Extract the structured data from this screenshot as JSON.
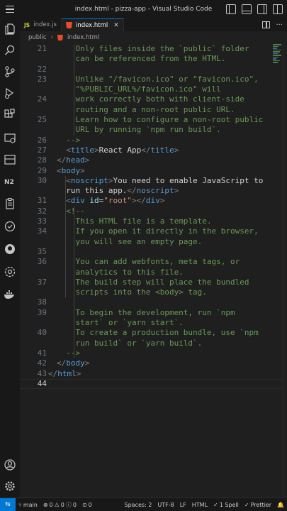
{
  "window": {
    "title": "index.html - pizza-app - Visual Studio Code"
  },
  "tabs": [
    {
      "label": "index.js",
      "badge": "JS"
    },
    {
      "label": "index.html",
      "active": true
    }
  ],
  "tab_actions": {
    "more": "···"
  },
  "breadcrumb": {
    "folder": "public",
    "separator": "›",
    "file": "index.html"
  },
  "editor": {
    "line_numbers": [
      "21",
      "",
      "22",
      "23",
      "",
      "24",
      "",
      "25",
      "",
      "26",
      "27",
      "28",
      "29",
      "30",
      "",
      "31",
      "32",
      "33",
      "34",
      "",
      "35",
      "36",
      "",
      "37",
      "",
      "38",
      "39",
      "",
      "40",
      "",
      "41",
      "42",
      "43",
      "44"
    ],
    "current_line": "44"
  },
  "statusbar": {
    "remote_icon": "⇆",
    "branch": "main",
    "errors": "0",
    "warnings": "0",
    "info": "0",
    "ports": "0",
    "spaces": "Spaces: 2",
    "encoding": "UTF-8",
    "eol": "LF",
    "language": "HTML",
    "spell": "1 Spell",
    "prettier": "Prettier",
    "bell": "🔔"
  }
}
